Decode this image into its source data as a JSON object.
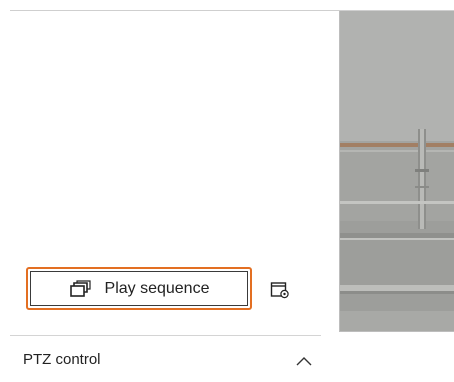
{
  "sequence": {
    "play_label": "Play sequence"
  },
  "ptz": {
    "label": "PTZ control"
  },
  "icons": {
    "play_sequence": "multi-window-icon",
    "settings": "window-settings-icon",
    "collapse": "chevron-up-icon"
  },
  "colors": {
    "focus_outline": "#e36f22"
  }
}
